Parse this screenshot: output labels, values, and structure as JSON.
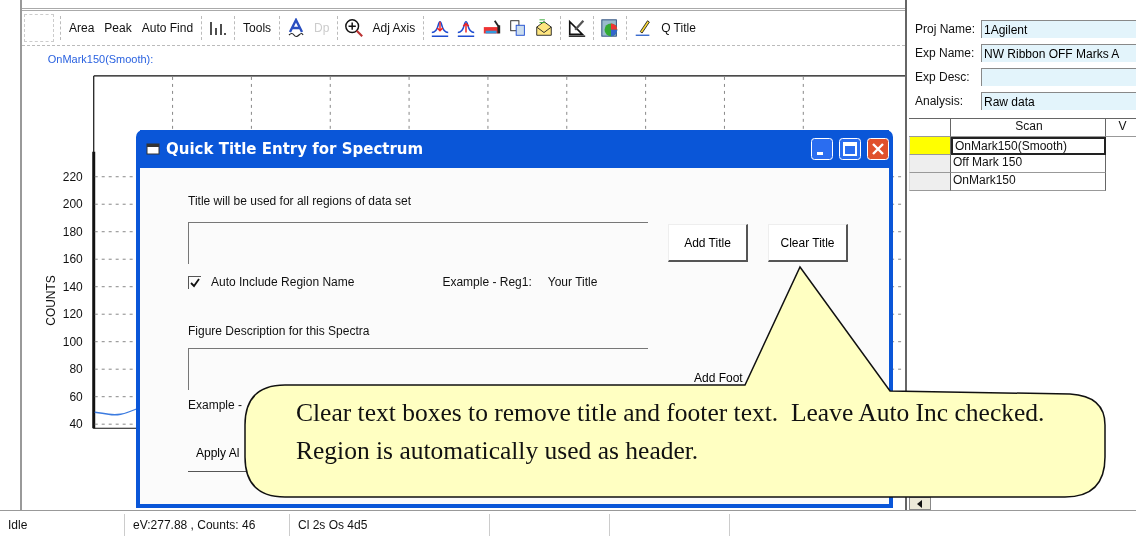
{
  "toolbar": {
    "buttons": [
      {
        "label": "Area",
        "disabled": false
      },
      {
        "label": "Peak",
        "disabled": false
      },
      {
        "label": "Auto Find",
        "disabled": false
      },
      {
        "label": "Tools",
        "disabled": false
      },
      {
        "label": "Dp",
        "disabled": true
      },
      {
        "label": "Adj Axis",
        "disabled": false
      },
      {
        "label": "Q Title",
        "disabled": false
      }
    ]
  },
  "chart": {
    "title": "OnMark150(Smooth):",
    "ylabel": "COUNTS",
    "yticks": [
      "220",
      "200",
      "180",
      "160",
      "140",
      "120",
      "100",
      "80",
      "60",
      "40"
    ]
  },
  "dialog": {
    "title": "Quick Title Entry for Spectrum",
    "title_label": "Title will be used for all regions of data set",
    "add_title": "Add Title",
    "clear_title": "Clear Title",
    "auto_include": {
      "label": "Auto Include Region Name",
      "checked": true
    },
    "example_label": "Example - Reg1:",
    "example_value": "Your Title",
    "figure_label": "Figure Description for this Spectra",
    "add_footer": "Add Foot",
    "footer_example": "Example -",
    "apply": "Apply Al"
  },
  "callout": {
    "text": "Clear text boxes to remove title and footer text.  Leave Auto Inc checked.  Region is automatically used as header."
  },
  "project": {
    "fields": [
      {
        "label": "Proj Name:",
        "value": "1Agilent"
      },
      {
        "label": "Exp Name:",
        "value": "NW Ribbon OFF Marks A"
      },
      {
        "label": "Exp Desc:"
      },
      {
        "label": "Analysis:",
        "value": "Raw data"
      }
    ]
  },
  "scans": {
    "columns": [
      "Scan",
      "V"
    ],
    "rows": [
      {
        "name": "OnMark150(Smooth)",
        "color": "#ffff00",
        "selected": true
      },
      {
        "name": "Off Mark 150",
        "color": "#eeeeee",
        "selected": false
      },
      {
        "name": "OnMark150",
        "color": "#eeeeee",
        "selected": false
      }
    ]
  },
  "status_bar": [
    "Idle",
    "eV:277.88 , Counts: 46",
    "Cl 2s  Os 4d5"
  ]
}
